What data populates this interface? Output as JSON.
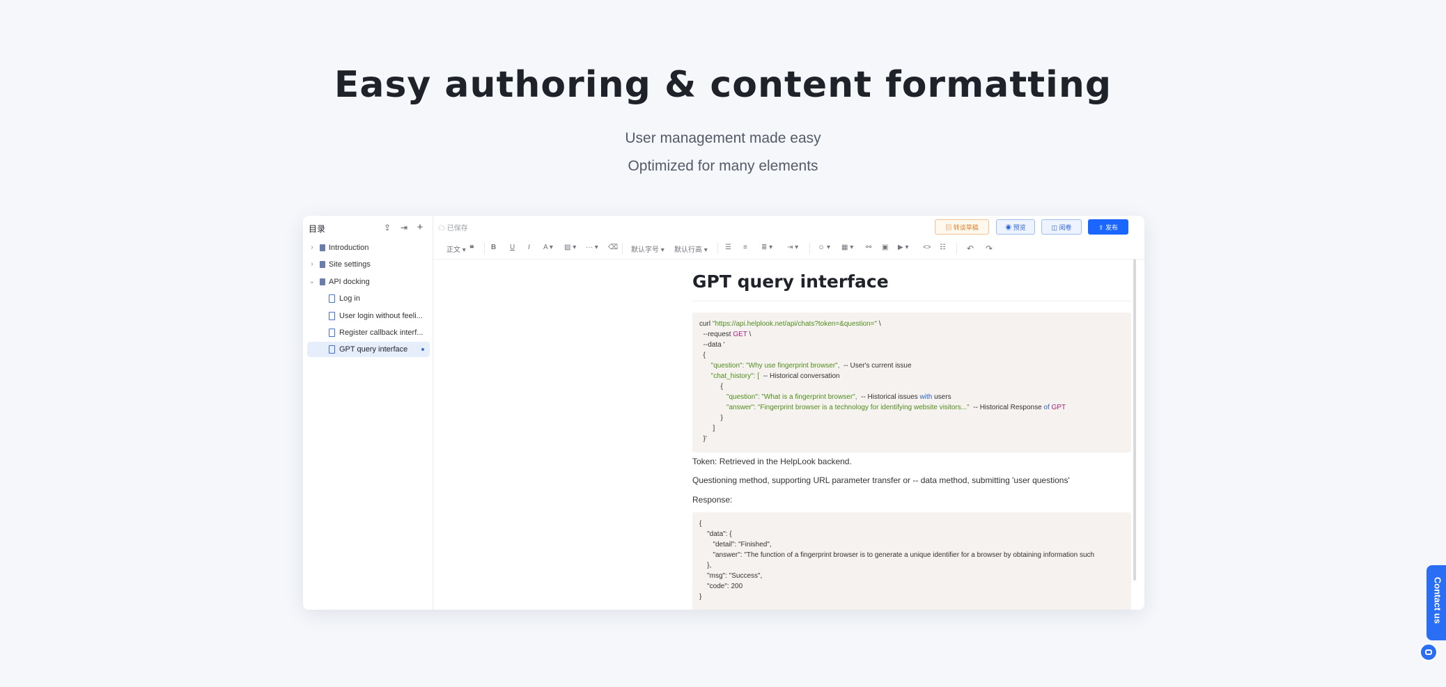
{
  "hero": {
    "title": "Easy authoring & content formatting",
    "subtitle1": "User management made easy",
    "subtitle2": "Optimized for many elements"
  },
  "sidebar": {
    "title": "目录",
    "items": [
      {
        "label": "Introduction",
        "type": "book",
        "expanded": false
      },
      {
        "label": "Site settings",
        "type": "book",
        "expanded": false
      },
      {
        "label": "API docking",
        "type": "book",
        "expanded": true
      },
      {
        "label": "Log in",
        "type": "doc"
      },
      {
        "label": "User login without feeli...",
        "type": "doc"
      },
      {
        "label": "Register callback interf...",
        "type": "doc"
      },
      {
        "label": "GPT query interface",
        "type": "doc",
        "active": true
      }
    ]
  },
  "topbar": {
    "saved_status": "已保存",
    "draft_label": "转谈草稿",
    "preview_label": "预览",
    "read_label": "阅卷",
    "publish_label": "发布"
  },
  "toolbar": {
    "paragraph": "正文",
    "font_size": "默认字号",
    "line_height": "默认行高"
  },
  "editor": {
    "title": "GPT query interface",
    "code1": [
      [
        "curl ",
        "\"https://api.helplook.net/api/chats?token=&question=\"",
        " \\"
      ],
      [
        "  --request ",
        "GET",
        " \\"
      ],
      [
        "  --data '"
      ],
      [
        "  {"
      ],
      [
        "      ",
        "\"question\": \"Why use fingerprint browser\",",
        "  -- User's current issue"
      ],
      [
        "      ",
        "\"chat_history\": [",
        "  -- Historical conversation"
      ],
      [
        "           {"
      ],
      [
        "              ",
        "\"question\": \"What is a fingerprint browser\",",
        "  -- Historical issues ",
        "with",
        " users"
      ],
      [
        "              ",
        "\"answer\": \"Fingerprint browser is a technology for identifying website visitors...\"",
        "  -- Historical Response ",
        "of",
        " ",
        "GPT"
      ],
      [
        "           }"
      ],
      [
        "       ]"
      ],
      [
        "  }'"
      ]
    ],
    "para1": "Token: Retrieved in the HelpLook backend.",
    "para2": "Questioning method, supporting URL parameter transfer or -- data method, submitting 'user questions'",
    "para3": "Response:",
    "code2": [
      "{",
      "    \"data\": {",
      "       \"detail\": \"Finished\",",
      "       \"answer\": \"The function of a fingerprint browser is to generate a unique identifier for a browser by obtaining information such",
      "    },",
      "    \"msg\": \"Success\",",
      "    \"code\": 200",
      "}"
    ]
  },
  "contact": {
    "label": "Contact us"
  },
  "colors": {
    "accent": "#1a66ff",
    "background": "#f5f7fb",
    "code_bg": "#f5f2ef"
  }
}
